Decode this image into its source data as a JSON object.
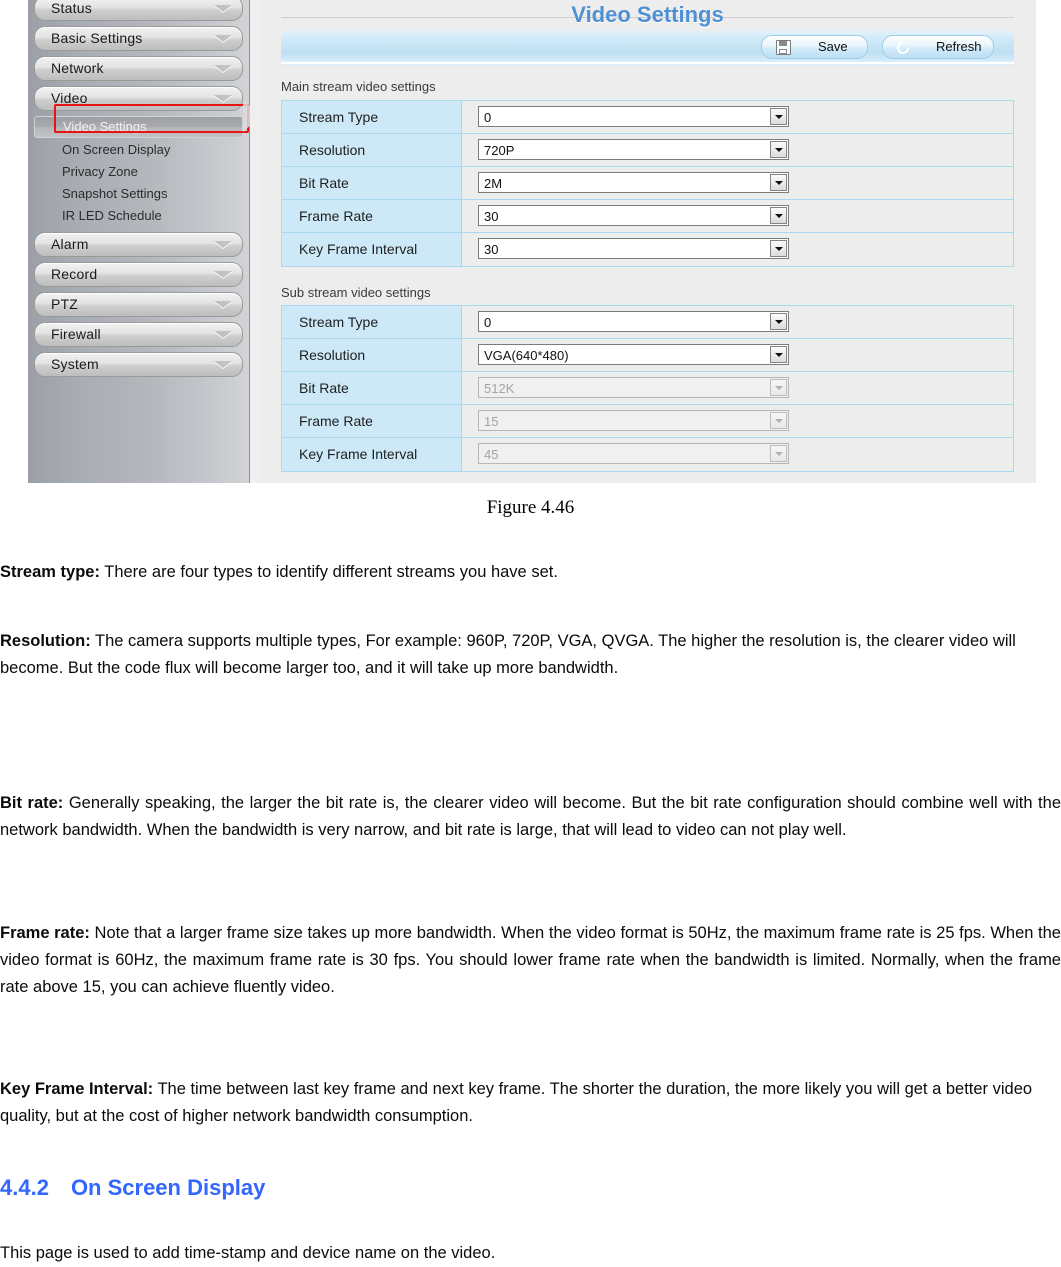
{
  "screenshot": {
    "nav": {
      "groups_and_items": [
        {
          "type": "group",
          "label": "Status",
          "icon": "chevron-down-icon"
        },
        {
          "type": "group",
          "label": "Basic Settings",
          "icon": "chevron-down-icon"
        },
        {
          "type": "group",
          "label": "Network",
          "icon": "chevron-down-icon"
        },
        {
          "type": "group",
          "label": "Video",
          "icon": "chevron-down-icon"
        },
        {
          "type": "item",
          "label": "Video Settings",
          "active": true,
          "highlighted": true
        },
        {
          "type": "item",
          "label": "On Screen Display",
          "active": false
        },
        {
          "type": "item",
          "label": "Privacy Zone",
          "active": false
        },
        {
          "type": "item",
          "label": "Snapshot Settings",
          "active": false
        },
        {
          "type": "item",
          "label": "IR LED Schedule",
          "active": false
        },
        {
          "type": "group",
          "label": "Alarm",
          "icon": "chevron-down-icon"
        },
        {
          "type": "group",
          "label": "Record",
          "icon": "chevron-down-icon"
        },
        {
          "type": "group",
          "label": "PTZ",
          "icon": "chevron-down-icon"
        },
        {
          "type": "group",
          "label": "Firewall",
          "icon": "chevron-down-icon"
        },
        {
          "type": "group",
          "label": "System",
          "icon": "chevron-down-icon"
        }
      ]
    },
    "panel": {
      "title": "Video Settings",
      "toolbar": {
        "save_label": "Save",
        "refresh_label": "Refresh",
        "save_icon": "floppy-disk-icon",
        "refresh_icon": "refresh-arrow-icon"
      },
      "main_stream": {
        "section_label": "Main stream video settings",
        "rows": [
          {
            "label": "Stream Type",
            "value": "0",
            "disabled": false
          },
          {
            "label": "Resolution",
            "value": "720P",
            "disabled": false
          },
          {
            "label": "Bit Rate",
            "value": "2M",
            "disabled": false
          },
          {
            "label": "Frame Rate",
            "value": "30",
            "disabled": false
          },
          {
            "label": "Key Frame Interval",
            "value": "30",
            "disabled": false
          }
        ]
      },
      "sub_stream": {
        "section_label": "Sub stream video settings",
        "rows": [
          {
            "label": "Stream Type",
            "value": "0",
            "disabled": false
          },
          {
            "label": "Resolution",
            "value": "VGA(640*480)",
            "disabled": false
          },
          {
            "label": "Bit Rate",
            "value": "512K",
            "disabled": true
          },
          {
            "label": "Frame Rate",
            "value": "15",
            "disabled": true
          },
          {
            "label": "Key Frame Interval",
            "value": "45",
            "disabled": true
          }
        ]
      }
    },
    "colors": {
      "title_blue": "#4f8fd3",
      "row_label_blue": "#cde9f7",
      "table_border_blue": "#a9d8ef",
      "toolbar_blue": "#c9e6f6",
      "highlight_red": "#e81313",
      "heading_blue": "#3366ff"
    }
  },
  "document": {
    "figure_caption": "Figure 4.46",
    "paragraphs": [
      {
        "term": "Stream type:",
        "text": " There are four types to identify different streams you have set."
      },
      {
        "term": "Resolution:",
        "text": " The camera supports multiple types, For example: 960P, 720P, VGA, QVGA. The higher the resolution is, the clearer video will become. But the code flux will become larger too, and it will take up more bandwidth."
      },
      {
        "term": "Bit rate:",
        "text": " Generally speaking, the larger the bit rate is, the clearer video will become. But the bit rate configuration should combine well with the network bandwidth. When the bandwidth is very narrow, and bit rate is large, that will lead to video can not play well."
      },
      {
        "term": "Frame rate:",
        "text": " Note that a larger frame size takes up more bandwidth. When the video format is 50Hz, the maximum frame rate is 25 fps. When the video format is 60Hz, the maximum frame rate is 30 fps. You should lower frame rate when the bandwidth is limited. Normally, when the frame rate above 15, you can achieve fluently video."
      },
      {
        "term": "Key Frame Interval:",
        "text": " The time between last key frame and next key frame. The shorter the duration, the more likely you will get a better video quality, but at the cost of higher network bandwidth consumption."
      }
    ],
    "heading": {
      "number": "4.4.2",
      "text": "On Screen Display"
    },
    "closing": "This page is used to add time-stamp and device name on the video."
  }
}
